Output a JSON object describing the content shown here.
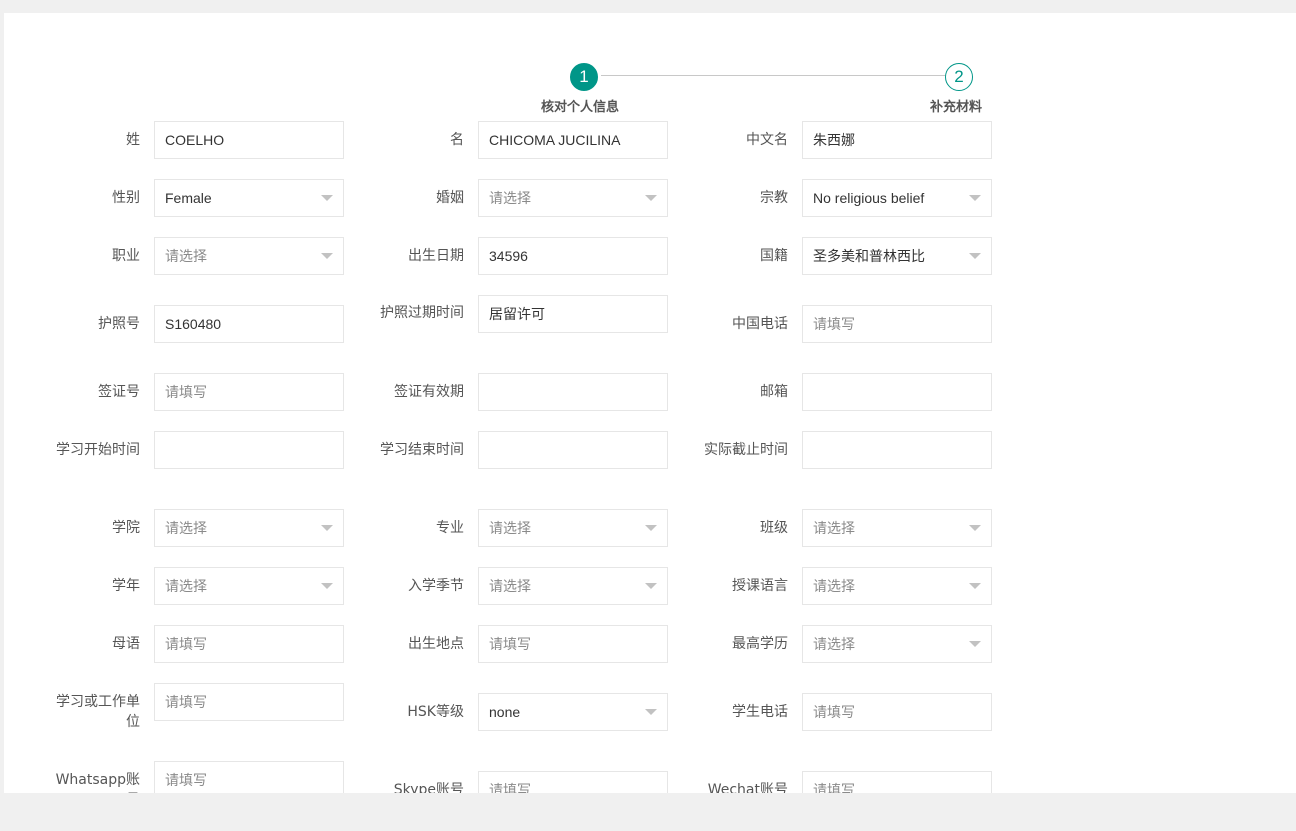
{
  "steps": [
    {
      "number": "1",
      "title": "核对个人信息"
    },
    {
      "number": "2",
      "title": "补充材料"
    }
  ],
  "form": {
    "surname": {
      "label": "姓",
      "value": "COELHO"
    },
    "given_name": {
      "label": "名",
      "value": "CHICOMA JUCILINA"
    },
    "chinese_name": {
      "label": "中文名",
      "value": "朱西娜"
    },
    "gender": {
      "label": "性别",
      "value": "Female"
    },
    "marital": {
      "label": "婚姻",
      "placeholder": "请选择"
    },
    "religion": {
      "label": "宗教",
      "value": "No religious belief"
    },
    "occupation": {
      "label": "职业",
      "placeholder": "请选择"
    },
    "birth_date": {
      "label": "出生日期",
      "value": "34596"
    },
    "nationality": {
      "label": "国籍",
      "value": "圣多美和普林西比"
    },
    "passport_no": {
      "label": "护照号",
      "value": "S160480"
    },
    "passport_expiry": {
      "label": "护照过期时间",
      "value": "居留许可"
    },
    "china_phone": {
      "label": "中国电话",
      "placeholder": "请填写"
    },
    "visa_no": {
      "label": "签证号",
      "placeholder": "请填写"
    },
    "visa_validity": {
      "label": "签证有效期",
      "value": ""
    },
    "email": {
      "label": "邮箱",
      "value": ""
    },
    "study_start": {
      "label": "学习开始时间",
      "value": ""
    },
    "study_end": {
      "label": "学习结束时间",
      "value": ""
    },
    "actual_end": {
      "label": "实际截止时间",
      "value": ""
    },
    "college": {
      "label": "学院",
      "placeholder": "请选择"
    },
    "major": {
      "label": "专业",
      "placeholder": "请选择"
    },
    "class": {
      "label": "班级",
      "placeholder": "请选择"
    },
    "school_year": {
      "label": "学年",
      "placeholder": "请选择"
    },
    "entry_season": {
      "label": "入学季节",
      "placeholder": "请选择"
    },
    "teaching_language": {
      "label": "授课语言",
      "placeholder": "请选择"
    },
    "native_language": {
      "label": "母语",
      "placeholder": "请填写"
    },
    "birth_place": {
      "label": "出生地点",
      "placeholder": "请填写"
    },
    "highest_degree": {
      "label": "最高学历",
      "placeholder": "请选择"
    },
    "work_unit": {
      "label": "学习或工作单位",
      "placeholder": "请填写"
    },
    "hsk_level": {
      "label": "HSK等级",
      "value": "none"
    },
    "student_phone": {
      "label": "学生电话",
      "placeholder": "请填写"
    },
    "whatsapp": {
      "label": "Whatsapp账号",
      "placeholder": "请填写"
    },
    "skype": {
      "label": "Skype账号",
      "placeholder": "请填写"
    },
    "wechat": {
      "label": "Wechat账号",
      "placeholder": "请填写"
    }
  },
  "colors": {
    "accent": "#009688",
    "border": "#e6e6e6",
    "placeholder": "#8a8a8a"
  }
}
